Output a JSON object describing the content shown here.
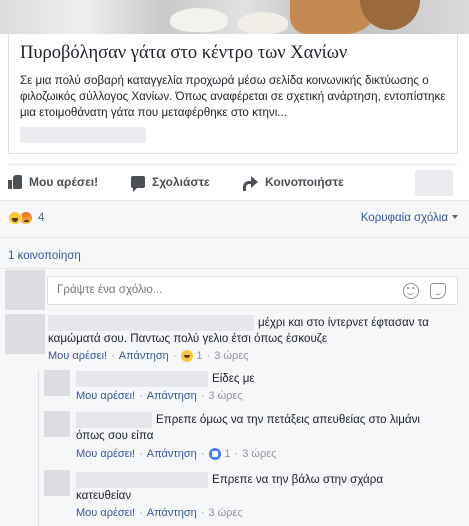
{
  "article": {
    "title": "Πυροβόλησαν γάτα στο κέντρο των Χανίων",
    "description": "Σε μια πολύ σοβαρή καταγγελία προχωρά μέσω σελίδα κοινωνικής δικτύωσης ο φιλοζωικός σύλλογος Χανίων. Όπως αναφέρεται σε σχετική ανάρτηση, εντοπίστηκε μια ετοιμοθάνατη γάτα που μεταφέρθηκε στο κτηνι..."
  },
  "actions": {
    "like": "Μου αρέσει!",
    "comment": "Σχολιάστε",
    "share": "Κοινοποιήστε"
  },
  "reactions": {
    "count": "4",
    "types": [
      "haha-icon",
      "angry-icon"
    ]
  },
  "sort": {
    "label": "Κορυφαία σχόλια"
  },
  "shares": {
    "label": "1 κοινοποίηση"
  },
  "composer": {
    "placeholder": "Γράψτε ένα σχόλιο..."
  },
  "comments": [
    {
      "text_line1": "μέχρι και στο ίντερνετ έφτασαν τα",
      "text_line2": "καμώματά σου. Παντως πολύ γελιο έτσι όπως έσκουζε",
      "like": "Μου αρέσει!",
      "reply": "Απάντηση",
      "reaction_count": "1",
      "time": "3 ώρες",
      "reaction_icon": "haha-icon"
    }
  ],
  "replies": [
    {
      "text_line1": "Είδες με",
      "like": "Μου αρέσει!",
      "reply": "Απάντηση",
      "time": "3 ώρες"
    },
    {
      "text_line1": "Επρεπε όμως να την πετάξεις απευθείας στο λιμάνι",
      "text_line2": "όπως σου είπα",
      "like": "Μου αρέσει!",
      "reply": "Απάντηση",
      "reaction_count": "1",
      "time": "3 ώρες",
      "reaction_icon": "like-icon"
    },
    {
      "text_line1": "Επρεπε να την βάλω στην σχάρα",
      "text_line2": "κατευθείαν",
      "like": "Μου αρέσει!",
      "reply": "Απάντηση",
      "time": "3 ώρες"
    }
  ],
  "colors": {
    "link": "#365899",
    "meta": "#90949c",
    "panel": "#f6f7f9",
    "like_blue": "#4080ff",
    "haha_yellow": "#f7c93a"
  }
}
